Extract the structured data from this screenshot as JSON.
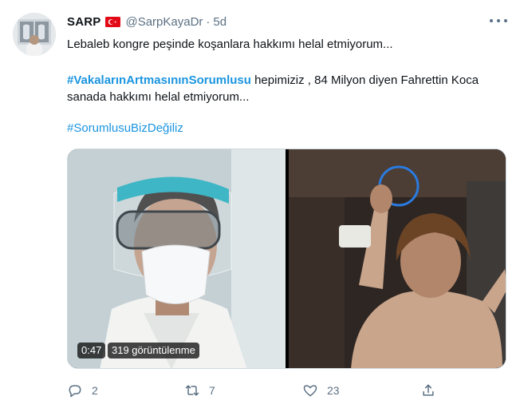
{
  "author": {
    "display_name": "SARP",
    "handle": "@SarpKayaDr",
    "separator": "·",
    "time": "5d",
    "flag": "turkish-flag-icon"
  },
  "tweet": {
    "line1": "Lebaleb kongre peşinde koşanlara hakkımı helal etmiyorum...",
    "hashtag1": "#VakalarınArtmasınınSorumlusu",
    "line2_rest": " hepimiziz , 84 Milyon diyen Fahrettin Koca sanada hakkımı helal etmiyorum...",
    "hashtag2": "#SorumlusuBizDeğiliz"
  },
  "media": {
    "duration": "0:47",
    "views": "319 görüntülenme"
  },
  "actions": {
    "replies": "2",
    "retweets": "7",
    "likes": "23"
  },
  "colors": {
    "link": "#1b95e0",
    "muted": "#5b7083",
    "text": "#0f1419"
  }
}
